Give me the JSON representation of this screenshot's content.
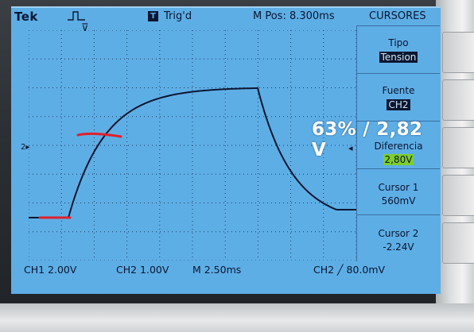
{
  "header": {
    "brand": "Tek",
    "trigger_status": "Trig'd",
    "m_pos": "M Pos: 8.300ms",
    "menu_title": "CURSORES",
    "trigger_badge": "T"
  },
  "markers": {
    "trigger_position": "⊽",
    "channel_marker": "2▸",
    "reference_marker": "◂"
  },
  "menu": [
    {
      "label": "Tipo",
      "value": "Tension",
      "style": "inverted"
    },
    {
      "label": "Fuente",
      "value": "CH2",
      "style": "inverted"
    },
    {
      "label": "Diferencia",
      "value": "2,80V",
      "style": "highlight"
    },
    {
      "label": "Cursor 1",
      "value": "560mV",
      "style": "plain"
    },
    {
      "label": "Cursor 2",
      "value": "-2.24V",
      "style": "plain"
    }
  ],
  "footer": {
    "ch1": "CH1  2.00V",
    "ch2": "CH2  1.00V",
    "timebase": "M 2.50ms",
    "trigger": "CH2 ╱ 80.0mV"
  },
  "annotation": "63% / 2,82 V",
  "colors": {
    "screen": "#5eaee6",
    "trace": "#0b1630",
    "grid": "#0b1630",
    "cursor_mark": "#e0202a",
    "highlight": "#7ecf2a"
  }
}
